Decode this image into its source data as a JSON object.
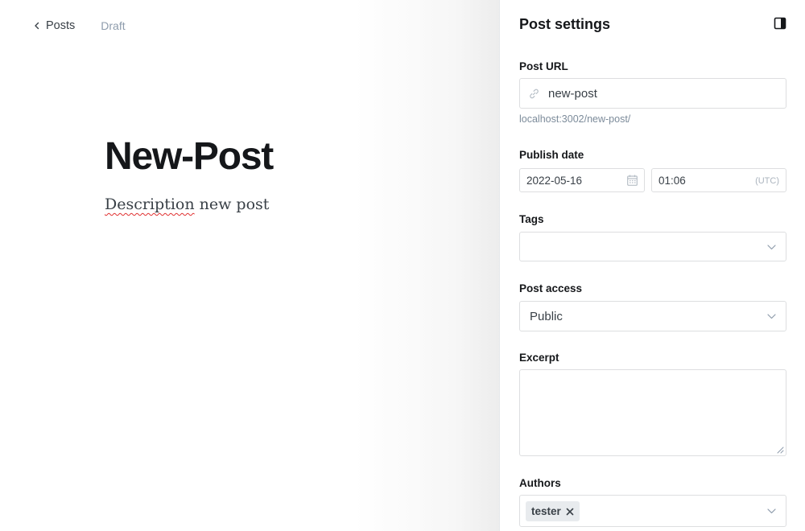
{
  "editor": {
    "back_label": "Posts",
    "status": "Draft",
    "title": "New-Post",
    "description_misspelled": "Description",
    "description_rest": " new post"
  },
  "settings": {
    "title": "Post settings",
    "toggle_icon": "sidebar-toggle-icon",
    "url": {
      "label": "Post URL",
      "icon": "link-icon",
      "value": "new-post",
      "preview": "localhost:3002/new-post/"
    },
    "publish_date": {
      "label": "Publish date",
      "date": "2022-05-16",
      "time": "01:06",
      "timezone": "(UTC)"
    },
    "tags": {
      "label": "Tags",
      "value": ""
    },
    "access": {
      "label": "Post access",
      "value": "Public"
    },
    "excerpt": {
      "label": "Excerpt",
      "value": ""
    },
    "authors": {
      "label": "Authors",
      "items": [
        "tester"
      ]
    }
  },
  "colors": {
    "text_primary": "#15171a",
    "text_secondary": "#394047",
    "muted": "#8e9cac",
    "border": "#dddee0",
    "token_bg": "#e8ebee"
  }
}
